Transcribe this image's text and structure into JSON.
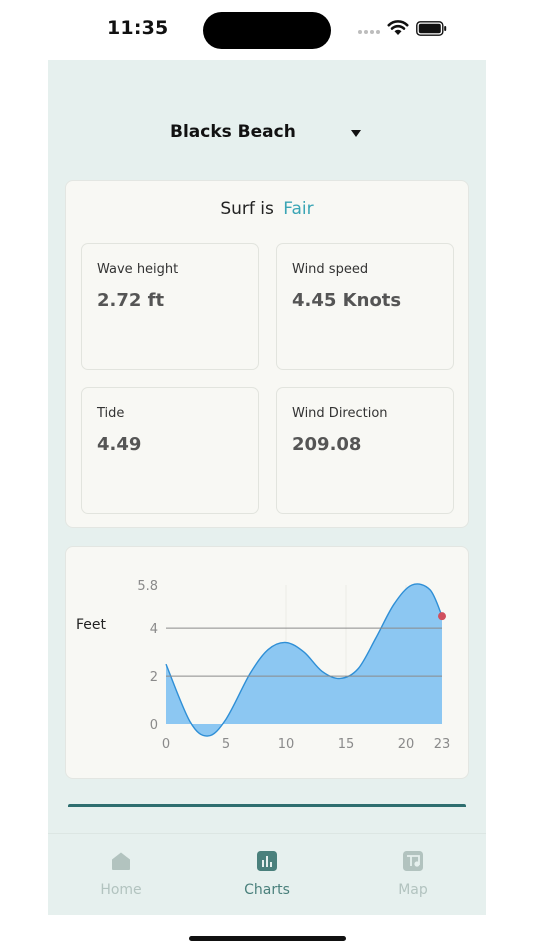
{
  "status_bar": {
    "time": "11:35"
  },
  "location": {
    "name": "Blacks Beach"
  },
  "summary": {
    "prefix": "Surf is",
    "rating": "Fair",
    "rating_color": "#3aa5b5",
    "metrics": [
      {
        "label": "Wave height",
        "value": "2.72 ft"
      },
      {
        "label": "Wind speed",
        "value": "4.45 Knots"
      },
      {
        "label": "Tide",
        "value": "4.49"
      },
      {
        "label": "Wind Direction",
        "value": "209.08"
      }
    ]
  },
  "chart_data": {
    "type": "area",
    "ylabel": "Feet",
    "x_ticks": [
      "0",
      "5",
      "10",
      "15",
      "20",
      "23"
    ],
    "y_ticks": [
      "0",
      "2",
      "4",
      "5.8"
    ],
    "xlim": [
      0,
      23
    ],
    "ylim": [
      0,
      5.8
    ],
    "fill_color": "#8cc7f2",
    "line_color": "#2f8fd6",
    "marker_color": "#d0505e",
    "series": [
      {
        "x": [
          0,
          2,
          3.5,
          5,
          7,
          8.5,
          10,
          11.5,
          13,
          14.5,
          16,
          17.5,
          19,
          20.5,
          22,
          23
        ],
        "values": [
          2.5,
          0.1,
          -0.5,
          0.2,
          2.1,
          3.1,
          3.4,
          3.0,
          2.2,
          1.9,
          2.3,
          3.6,
          5.0,
          5.8,
          5.6,
          4.5
        ]
      }
    ],
    "current_point": {
      "x": 23,
      "value": 4.5
    }
  },
  "tabs": [
    {
      "label": "Home",
      "icon": "home-icon"
    },
    {
      "label": "Charts",
      "icon": "chart-icon",
      "active": true
    },
    {
      "label": "Map",
      "icon": "map-icon"
    }
  ]
}
